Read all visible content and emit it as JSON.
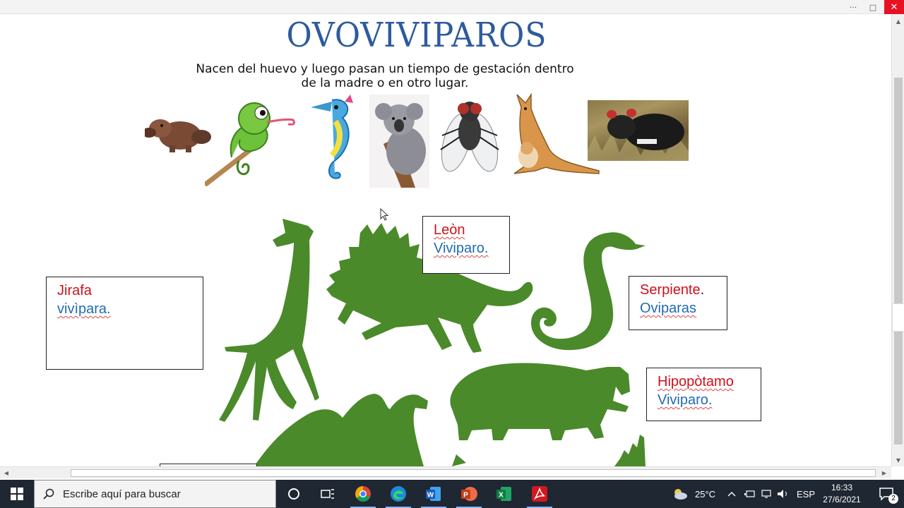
{
  "window": {
    "more_label": "···",
    "restore_label": "□",
    "close_label": "✕"
  },
  "document": {
    "title": "OVOVIVIPAROS",
    "subtitle_line1": "Nacen del huevo y luego pasan un tiempo de gestación dentro",
    "subtitle_line2": "de la madre o en otro lugar.",
    "pictures": [
      "platypus",
      "chameleon",
      "seahorse",
      "koala",
      "fly",
      "kangaroo",
      "tasmanian-devil-photo"
    ],
    "silhouettes": [
      "giraffe",
      "lion",
      "snake",
      "hippopotamus",
      "camel",
      "crocodile"
    ],
    "labels": {
      "jirafa": {
        "name": "Jirafa",
        "kind": "vivìpara."
      },
      "leon": {
        "name": "Leòn",
        "kind": "Viviparo."
      },
      "serpiente": {
        "name": "Serpiente",
        "dot": ".",
        "kind": "Oviparas"
      },
      "hipopotamo": {
        "name": "Hipopòtamo",
        "kind": "Viviparo."
      }
    },
    "silhouette_color": "#4a8a2a",
    "title_color": "#2e5a9e",
    "name_color": "#d0101c",
    "kind_color": "#1f6bb5"
  },
  "scrollbars": {
    "up": "▲",
    "down": "▼",
    "left": "◀",
    "right": "▶"
  },
  "taskbar": {
    "search_placeholder": "Escribe aquí para buscar",
    "apps": [
      "cortana-icon",
      "task-view-icon",
      "chrome-icon",
      "edge-icon",
      "word-icon",
      "powerpoint-icon",
      "excel-icon",
      "acrobat-icon"
    ],
    "weather": "25°C",
    "language": "ESP",
    "time": "16:33",
    "date": "27/6/2021",
    "notifications": "2"
  }
}
